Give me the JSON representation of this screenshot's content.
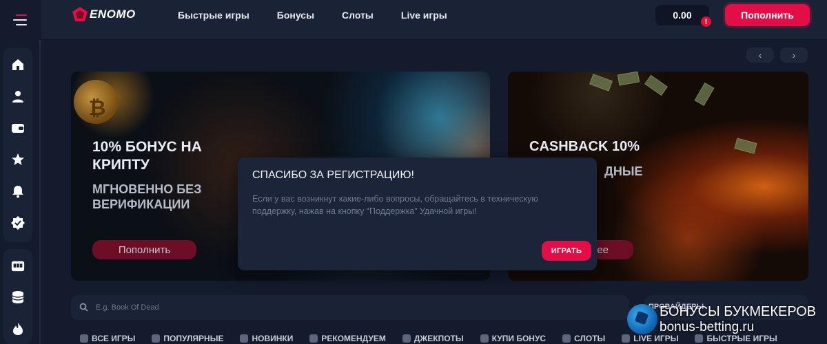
{
  "header": {
    "brand": "ENOMO",
    "nav": [
      "Быстрые игры",
      "Бонусы",
      "Слоты",
      "Live игры"
    ],
    "balance": "0.00",
    "alert_badge": "!",
    "deposit_label": "Пополнить"
  },
  "sidebar": {
    "group1": [
      "home-icon",
      "user-icon",
      "wallet-icon",
      "star-icon",
      "bell-icon",
      "verified-badge-icon"
    ],
    "group2": [
      "slot-machine-icon",
      "coin-stack-icon",
      "fire-icon"
    ]
  },
  "carousel": {
    "prev_icon": "‹",
    "next_icon": "›"
  },
  "banners": [
    {
      "title_line1": "10% БОНУС НА",
      "title_line2": "КРИПТУ",
      "sub_line1": "МГНОВЕННО БЕЗ",
      "sub_line2": "ВЕРИФИКАЦИИ",
      "button": "Пополнить"
    },
    {
      "title": "CASHBACK 10%",
      "sub": "ДНЫЕ",
      "button": "ее"
    }
  ],
  "modal": {
    "title": "СПАСИБО ЗА РЕГИСТРАЦИЮ!",
    "text": "Если у вас возникнут какие-либо вопросы, обращайтесь в техническую поддержку, нажав на кнопку “Поддержка” Удачной игры!",
    "button": "ИГРАТЬ"
  },
  "search": {
    "placeholder": "E.g. Book Of Dead"
  },
  "providers_label": "ПРОВАЙДЕРЫ",
  "categories": [
    "ВСЕ ИГРЫ",
    "ПОПУЛЯРНЫЕ",
    "НОВИНКИ",
    "РЕКОМЕНДУЕМ",
    "ДЖЕКПОТЫ",
    "КУПИ БОНУС",
    "СЛОТЫ",
    "LIVE ИГРЫ",
    "БЫСТРЫЕ ИГРЫ"
  ],
  "watermark": {
    "line1": "БОНУСЫ БУКМЕКЕРОВ",
    "line2": "bonus-betting.ru"
  },
  "colors": {
    "accent": "#e30d47",
    "panel": "#1a2236",
    "background": "#141b2d"
  }
}
